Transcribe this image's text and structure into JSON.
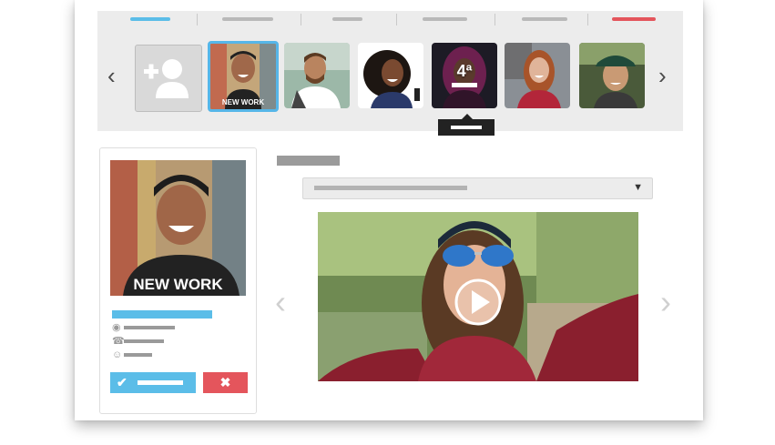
{
  "carousel": {
    "tabs": [
      {
        "color": "#5bbde8",
        "active": true
      },
      {
        "color": "#b9b9b9"
      },
      {
        "color": "#b9b9b9"
      },
      {
        "color": "#b9b9b9"
      },
      {
        "color": "#b9b9b9"
      },
      {
        "color": "#e4555c"
      }
    ],
    "prev_icon": "‹",
    "next_icon": "›",
    "selected_shirt_text": "NEW WORK",
    "age_badge": "4ª"
  },
  "profile": {
    "shirt_text": "NEW WORK",
    "icons": [
      "location-pin-icon",
      "phone-icon",
      "smiley-icon"
    ],
    "accept_icon": "✔",
    "reject_icon": "✖"
  },
  "video": {
    "prev_icon": "‹",
    "next_icon": "›",
    "dropdown_caret": "▼"
  },
  "colors": {
    "accent_blue": "#5bbde8",
    "reject_red": "#e4555c",
    "panel_gray": "#ececec"
  }
}
